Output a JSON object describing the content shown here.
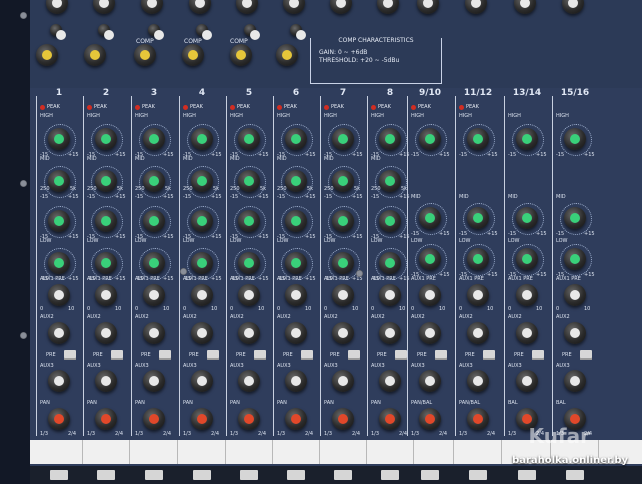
{
  "header": {
    "channel_labels": [
      "1",
      "2",
      "3",
      "4",
      "5",
      "6",
      "7",
      "8",
      "9/10",
      "11/12",
      "13/14",
      "15/16"
    ],
    "comp_labels": [
      "COMP",
      "COMP",
      "COMP",
      "COMP"
    ]
  },
  "comp_characteristics": {
    "title": "COMP CHARACTERISTICS",
    "gain": "GAIN: 0 ~ +6dB",
    "threshold": "THRESHOLD: +20 ~ -5dBu"
  },
  "strip_labels": {
    "peak": "PEAK",
    "high": "HIGH",
    "mid": "MID",
    "low": "LOW",
    "aux1": "AUX1 PRE",
    "aux2": "AUX2",
    "aux3": "AUX3",
    "pan": "PAN",
    "pan_bal": "PAN/BAL",
    "bal": "BAL",
    "pre": "PRE"
  },
  "knob_marks": {
    "minus15": "-15",
    "plus15": "+15",
    "f250": "250",
    "f5k": "5k",
    "zero": "0",
    "ten": "10",
    "pan_left": "1/3",
    "pan_right": "2/4"
  },
  "watermark": {
    "logo": "Kufar",
    "url": "baraholka.onliner.by"
  },
  "colors": {
    "panel": "#2f3d5c",
    "eq_knob": "#39d07a",
    "aux_knob": "#e8e8e8",
    "pan_knob": "#e1482a",
    "comp_knob": "#e6c63a",
    "peak_led": "#d12d22"
  }
}
